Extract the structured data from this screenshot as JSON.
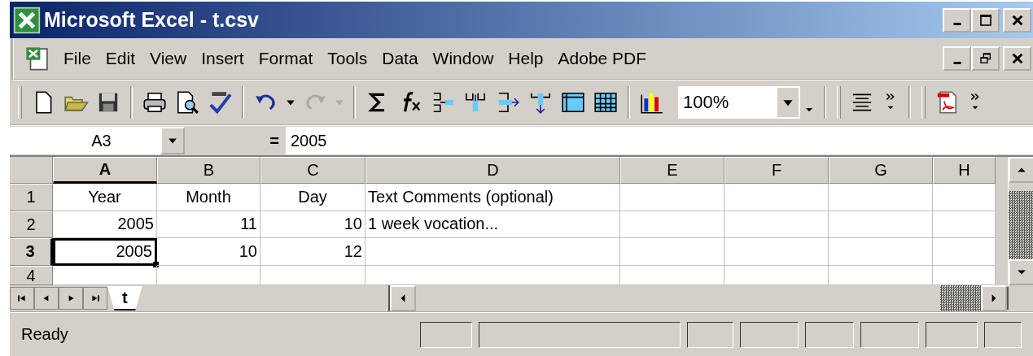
{
  "window": {
    "title": "Microsoft Excel - t.csv"
  },
  "menu": [
    {
      "label": "File"
    },
    {
      "label": "Edit"
    },
    {
      "label": "View"
    },
    {
      "label": "Insert"
    },
    {
      "label": "Format"
    },
    {
      "label": "Tools"
    },
    {
      "label": "Data"
    },
    {
      "label": "Window"
    },
    {
      "label": "Help"
    },
    {
      "label": "Adobe PDF"
    }
  ],
  "toolbar": {
    "zoom": "100%"
  },
  "formula_bar": {
    "name_box": "A3",
    "sign": "=",
    "value": "2005"
  },
  "columns": [
    {
      "label": "A",
      "selected": true
    },
    {
      "label": "B",
      "selected": false
    },
    {
      "label": "C",
      "selected": false
    },
    {
      "label": "D",
      "selected": false
    },
    {
      "label": "E",
      "selected": false
    },
    {
      "label": "F",
      "selected": false
    },
    {
      "label": "G",
      "selected": false
    },
    {
      "label": "H",
      "selected": false
    }
  ],
  "rows": [
    {
      "label": "1",
      "selected": false,
      "cells": [
        {
          "text": "Year",
          "kind": "heading",
          "selected": false
        },
        {
          "text": "Month",
          "kind": "heading",
          "selected": false
        },
        {
          "text": "Day",
          "kind": "heading",
          "selected": false
        },
        {
          "text": "Text Comments (optional)",
          "kind": "text",
          "selected": false
        }
      ]
    },
    {
      "label": "2",
      "selected": false,
      "cells": [
        {
          "text": "2005",
          "kind": "number",
          "selected": false
        },
        {
          "text": "11",
          "kind": "number",
          "selected": false
        },
        {
          "text": "10",
          "kind": "number",
          "selected": false
        },
        {
          "text": "1 week vocation...",
          "kind": "text",
          "selected": false
        }
      ]
    },
    {
      "label": "3",
      "selected": true,
      "cells": [
        {
          "text": "2005",
          "kind": "number",
          "selected": true
        },
        {
          "text": "10",
          "kind": "number",
          "selected": false
        },
        {
          "text": "12",
          "kind": "number",
          "selected": false
        }
      ]
    },
    {
      "label": "4",
      "selected": false,
      "cells": []
    }
  ],
  "sheet_tabs": [
    {
      "label": "t",
      "selected": true
    }
  ],
  "status_bar": {
    "text": "Ready"
  }
}
